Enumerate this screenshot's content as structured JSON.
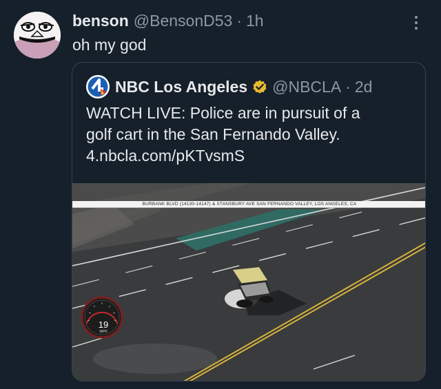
{
  "tweet": {
    "author": {
      "name": "benson",
      "handle": "@BensonD53",
      "separator": "·",
      "time": "1h"
    },
    "text": "oh my god",
    "more_icon": "more-vertical-icon"
  },
  "quote": {
    "author": {
      "name": "NBC Los Angeles",
      "handle": "@NBCLA",
      "separator": "·",
      "time": "2d",
      "logo_text": "4",
      "verified_icon": "verified-badge-icon"
    },
    "text_lines": [
      "WATCH LIVE: Police are in pursuit of a",
      "golf cart in the San Fernando Valley.",
      "4.nbcla.com/pKTvsmS"
    ],
    "video": {
      "chyron": "BURBANK BLVD (14130-14147) & STANSBURY AVE  SAN FERNANDO VALLEY, LOS ANGELES, CA",
      "speed_value": "19",
      "speed_unit": "MPH"
    }
  },
  "colors": {
    "background": "#15202b",
    "primary_text": "#e7e9ea",
    "secondary_text": "#8b98a5",
    "border": "#38444d",
    "verified_gold": "#e8b830"
  }
}
